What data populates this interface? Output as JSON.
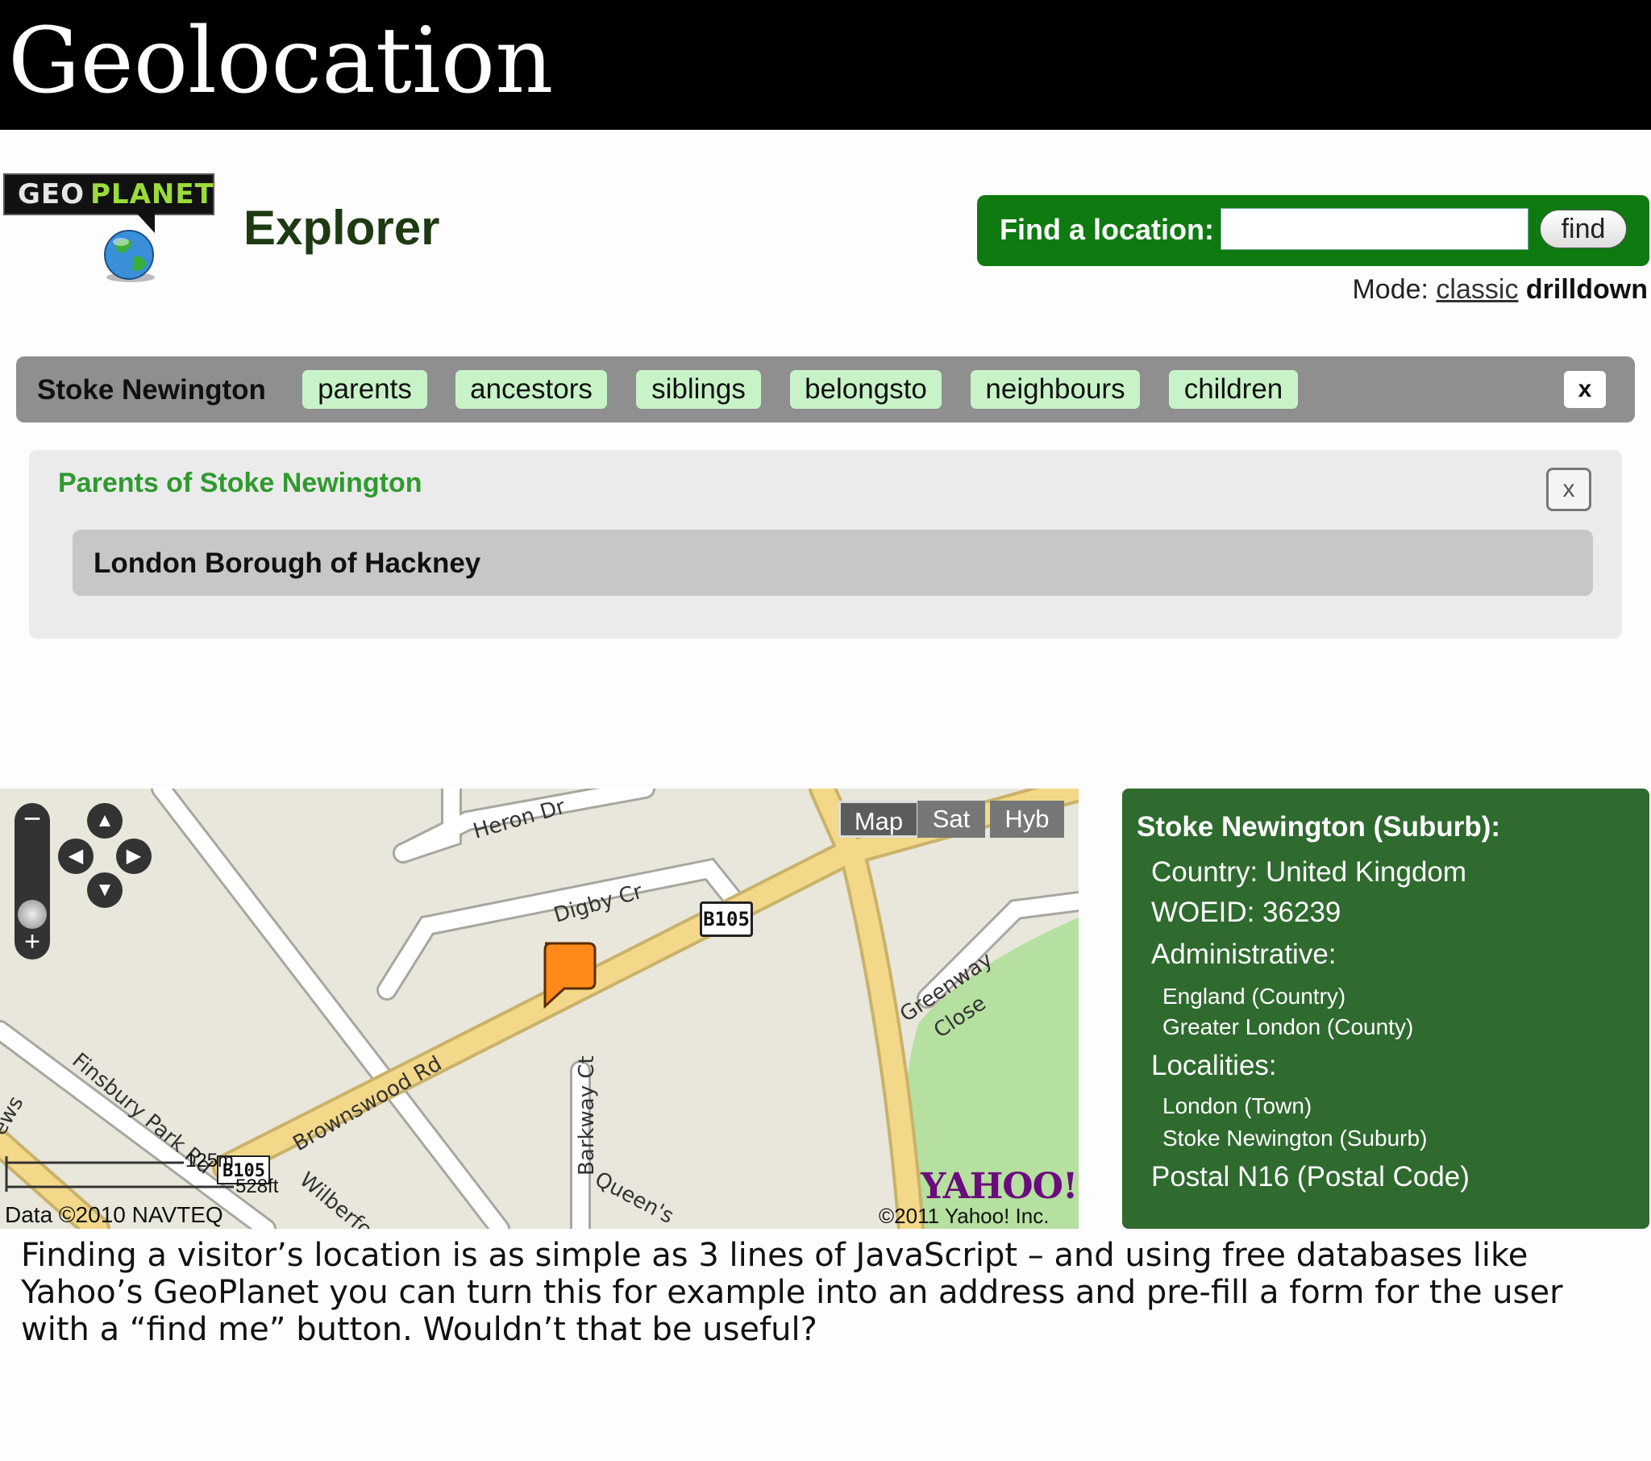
{
  "slide": {
    "title": "Geolocation"
  },
  "header": {
    "logo_geo": "GEO",
    "logo_planet": "PLANET",
    "app_title": "Explorer",
    "find_label": "Find a location:",
    "find_value": "",
    "find_button": "find",
    "mode_label": "Mode:",
    "mode_classic": "classic",
    "mode_drilldown": "drilldown"
  },
  "place_bar": {
    "place": "Stoke Newington",
    "tabs": [
      "parents",
      "ancestors",
      "siblings",
      "belongsto",
      "neighbours",
      "children"
    ],
    "close": "x"
  },
  "parents_panel": {
    "title": "Parents of Stoke Newington",
    "close": "x",
    "items": [
      "London Borough of Hackney"
    ]
  },
  "map": {
    "type_buttons": [
      "Map",
      "Sat",
      "Hyb"
    ],
    "zoom_minus": "−",
    "zoom_plus": "+",
    "road_labels": {
      "heron": "Heron Dr",
      "digby": "Digby Cr",
      "brownswood": "Brownswood Rd",
      "finsbury": "Finsbury Park Rd",
      "barkway": "Barkway Ct",
      "greenway": "Greenway",
      "close": "Close",
      "queens": "Queen's",
      "wilberforce": "Wilberfo",
      "ews": "ews"
    },
    "road_shield": "B105",
    "road_shield_small": "B105",
    "scale_m": "125m",
    "scale_ft": "528ft",
    "data_credit": "Data ©2010 NAVTEQ",
    "yahoo_logo": "YAHOO!",
    "yahoo_copyright": "©2011 Yahoo! Inc.",
    "colors": {
      "land": "#e9e6db",
      "road": "#ffffff",
      "major_road": "#f3d88a",
      "park": "#b5e0a0",
      "marker": "#ff8a1a"
    }
  },
  "info_panel": {
    "title": "Stoke Newington (Suburb):",
    "country": "Country: United Kingdom",
    "woeid": "WOEID: 36239",
    "administrative_label": "Administrative:",
    "administrative": [
      "England (Country)",
      "Greater London (County)"
    ],
    "localities_label": "Localities:",
    "localities": [
      "London (Town)",
      "Stoke Newington (Suburb)"
    ],
    "postal": "Postal N16 (Postal Code)"
  },
  "caption": {
    "lines": [
      "Finding a visitor’s location is as simple as 3 lines of JavaScript – and using free databases like",
      "Yahoo’s GeoPlanet you can turn this for example into an address and pre-fill a form for the user",
      "with a “find me” button. Wouldn’t that be useful?"
    ]
  }
}
